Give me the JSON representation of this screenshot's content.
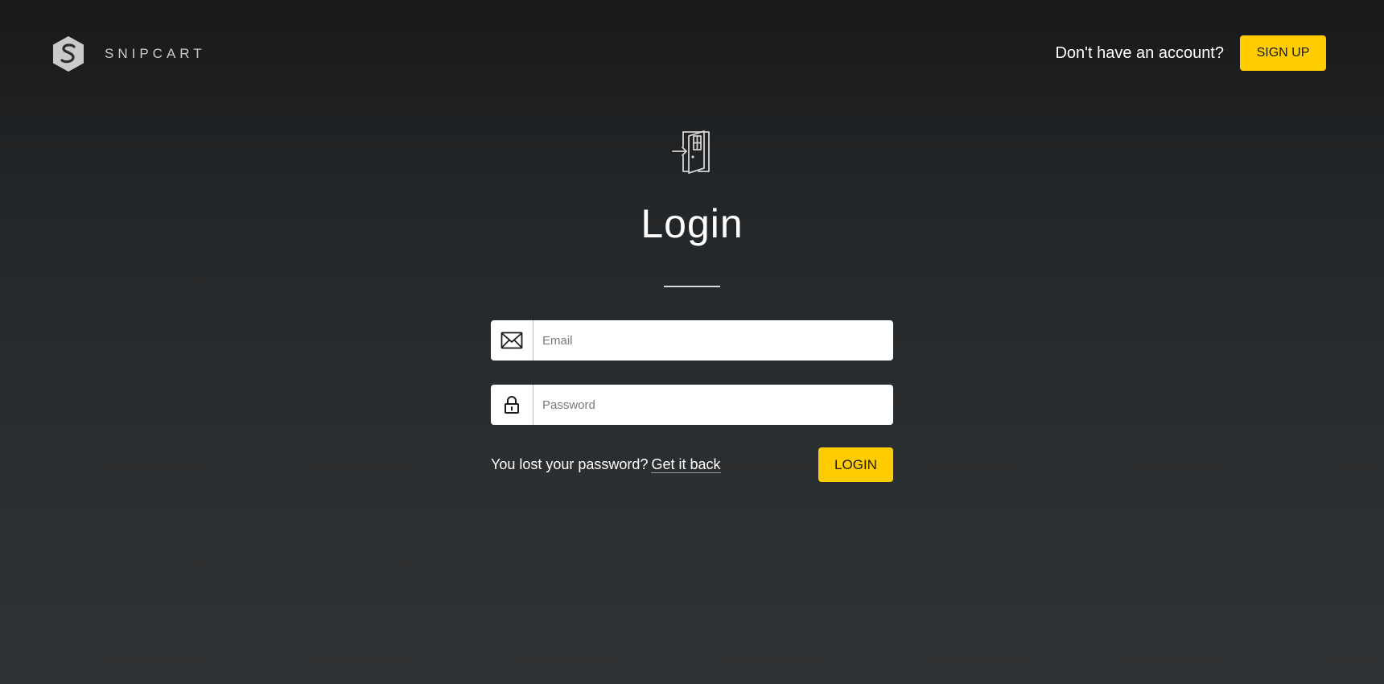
{
  "header": {
    "brand_name": "SNIPCART",
    "logo_icon": "snipcart-hexagon-logo",
    "signup_prompt": "Don't have an account?",
    "signup_label": "SIGN UP"
  },
  "main": {
    "hero_icon": "door-enter-icon",
    "title": "Login"
  },
  "form": {
    "email": {
      "icon": "envelope-icon",
      "placeholder": "Email",
      "value": ""
    },
    "password": {
      "icon": "lock-icon",
      "placeholder": "Password",
      "value": ""
    },
    "lost_password_text": "You lost your password?",
    "lost_password_link": "Get it back",
    "login_label": "LOGIN"
  },
  "colors": {
    "accent": "#ffcc00",
    "background_top": "#18191b",
    "background_bottom": "#303335"
  }
}
